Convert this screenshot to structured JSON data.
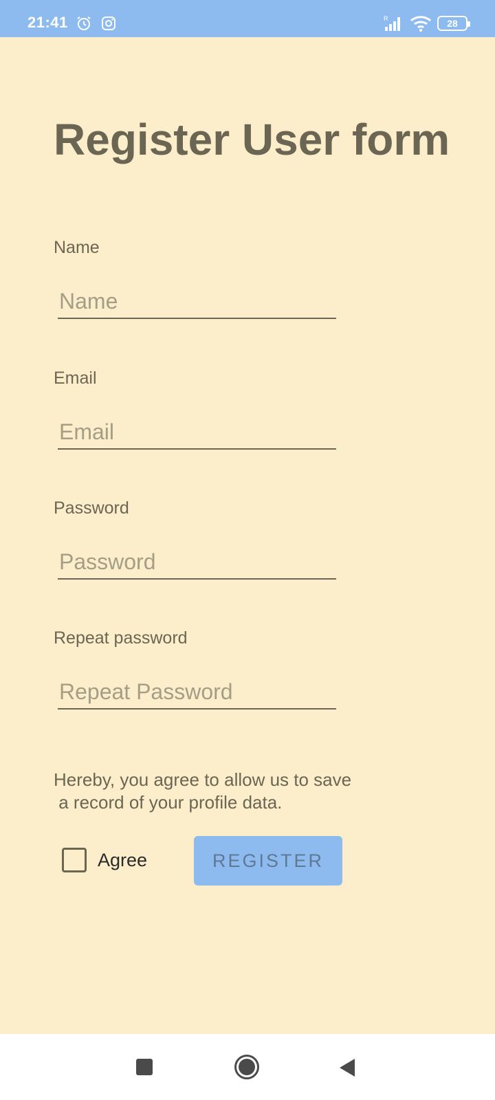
{
  "status_bar": {
    "time": "21:41",
    "battery": "28",
    "icons": [
      "alarm-icon",
      "instagram-icon",
      "signal-icon",
      "wifi-icon",
      "battery-icon"
    ],
    "background": "#8DBBF0"
  },
  "form": {
    "title": "Register User form",
    "fields": [
      {
        "label": "Name",
        "placeholder": "Name"
      },
      {
        "label": "Email",
        "placeholder": "Email"
      },
      {
        "label": "Password",
        "placeholder": "Password"
      },
      {
        "label": "Repeat password",
        "placeholder": "Repeat Password"
      }
    ],
    "consent_text": "Hereby, you agree to allow us to save\n a record of your profile data.",
    "agree_label": "Agree",
    "agree_checked": false,
    "register_label": "REGISTER"
  },
  "colors": {
    "background": "#FCEECB",
    "accent": "#8DBBF0",
    "text": "#6B6654"
  },
  "nav_bar": {
    "icons": [
      "recents-icon",
      "home-icon",
      "back-icon"
    ]
  }
}
